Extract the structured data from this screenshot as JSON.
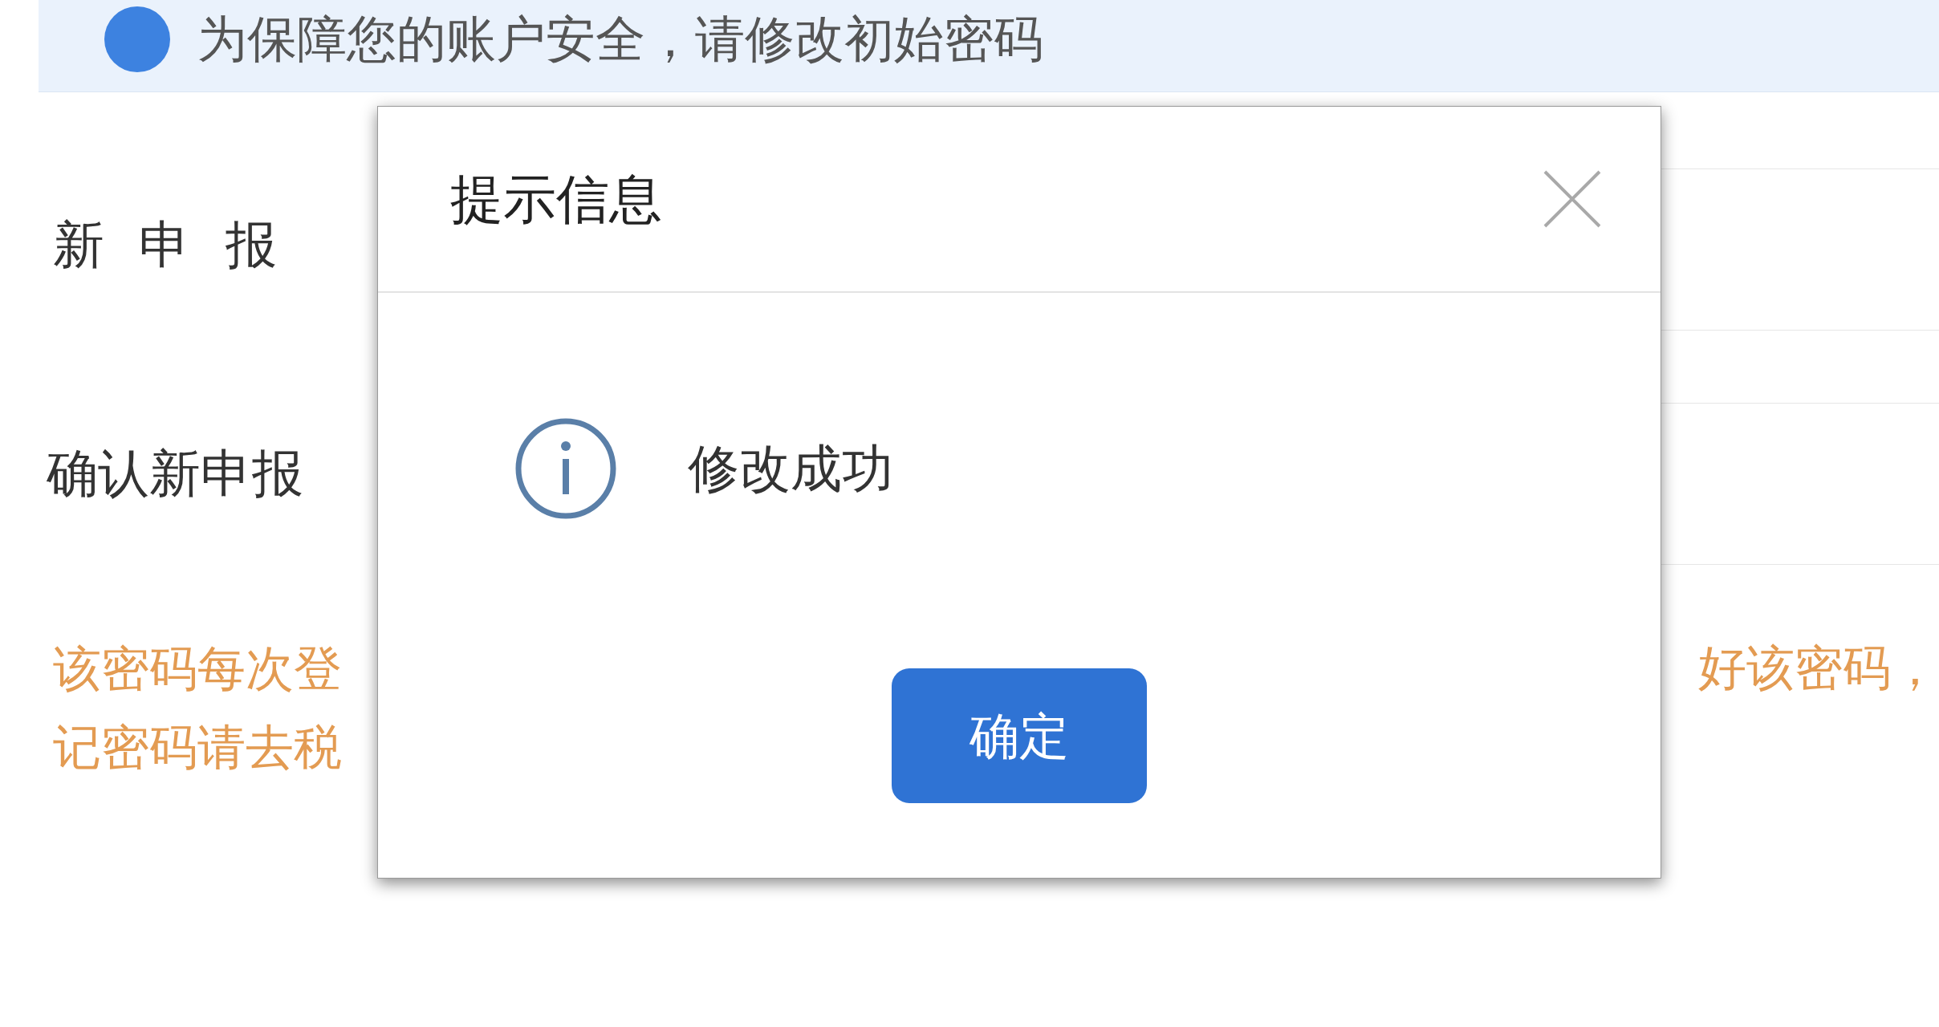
{
  "banner": {
    "message": "为保障您的账户安全，请修改初始密码"
  },
  "form": {
    "labels": [
      "新 申 报",
      "确认新申报"
    ],
    "note_lines": [
      "该密码每次登",
      "记密码请去税"
    ],
    "note_right": "好该密码，"
  },
  "dialog": {
    "title": "提示信息",
    "message": "修改成功",
    "confirm_button": "确定"
  }
}
